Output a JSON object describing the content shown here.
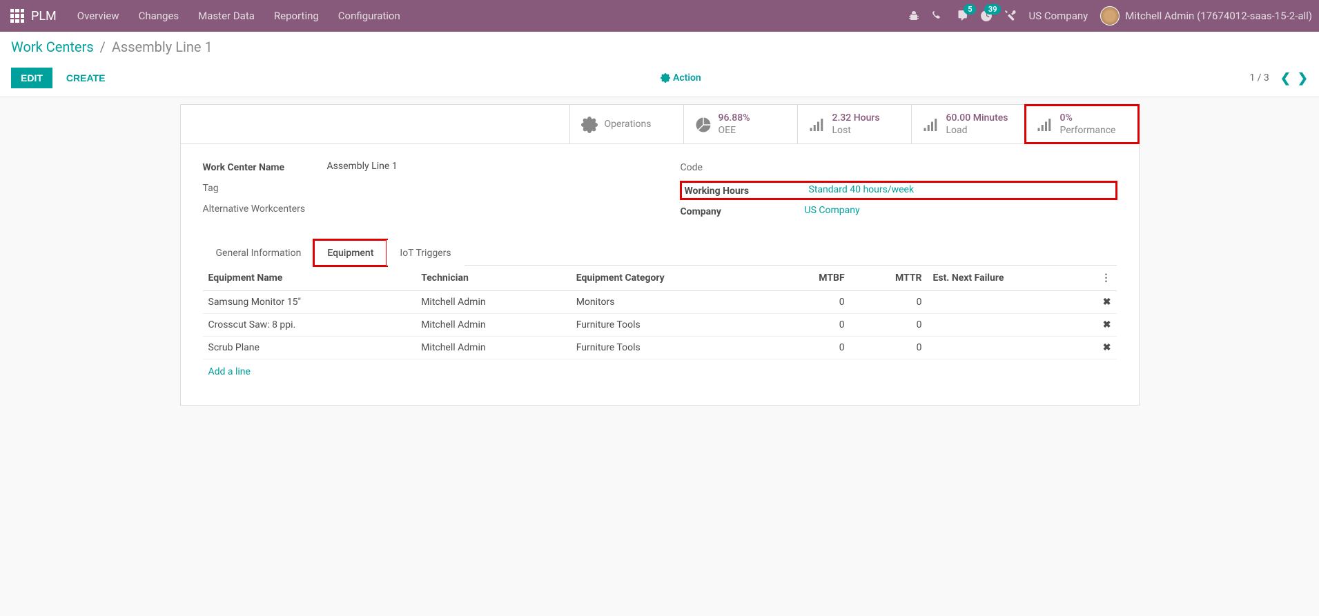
{
  "navbar": {
    "brand": "PLM",
    "menu": [
      "Overview",
      "Changes",
      "Master Data",
      "Reporting",
      "Configuration"
    ],
    "messages_badge": "5",
    "activities_badge": "39",
    "company": "US Company",
    "user": "Mitchell Admin (17674012-saas-15-2-all)"
  },
  "breadcrumb": {
    "parent": "Work Centers",
    "current": "Assembly Line 1"
  },
  "buttons": {
    "edit": "EDIT",
    "create": "CREATE",
    "action": "Action"
  },
  "pager": {
    "text": "1 / 3"
  },
  "stats": {
    "operations": {
      "label": "Operations"
    },
    "oee": {
      "value": "96.88%",
      "label": "OEE"
    },
    "lost": {
      "value": "2.32 Hours",
      "label": "Lost"
    },
    "load": {
      "value": "60.00 Minutes",
      "label": "Load"
    },
    "perf": {
      "value": "0%",
      "label": "Performance"
    }
  },
  "fields": {
    "name_label": "Work Center Name",
    "name_value": "Assembly Line 1",
    "tag_label": "Tag",
    "tag_value": "",
    "alt_label": "Alternative Workcenters",
    "alt_value": "",
    "code_label": "Code",
    "code_value": "",
    "hours_label": "Working Hours",
    "hours_value": "Standard 40 hours/week",
    "company_label": "Company",
    "company_value": "US Company"
  },
  "tabs": [
    "General Information",
    "Equipment",
    "IoT Triggers"
  ],
  "table": {
    "headers": {
      "name": "Equipment Name",
      "tech": "Technician",
      "cat": "Equipment Category",
      "mtbf": "MTBF",
      "mttr": "MTTR",
      "next": "Est. Next Failure"
    },
    "rows": [
      {
        "name": "Samsung Monitor 15\"",
        "tech": "Mitchell Admin",
        "cat": "Monitors",
        "mtbf": "0",
        "mttr": "0",
        "next": ""
      },
      {
        "name": "Crosscut Saw: 8 ppi.",
        "tech": "Mitchell Admin",
        "cat": "Furniture Tools",
        "mtbf": "0",
        "mttr": "0",
        "next": ""
      },
      {
        "name": "Scrub Plane",
        "tech": "Mitchell Admin",
        "cat": "Furniture Tools",
        "mtbf": "0",
        "mttr": "0",
        "next": ""
      }
    ],
    "add_line": "Add a line"
  }
}
